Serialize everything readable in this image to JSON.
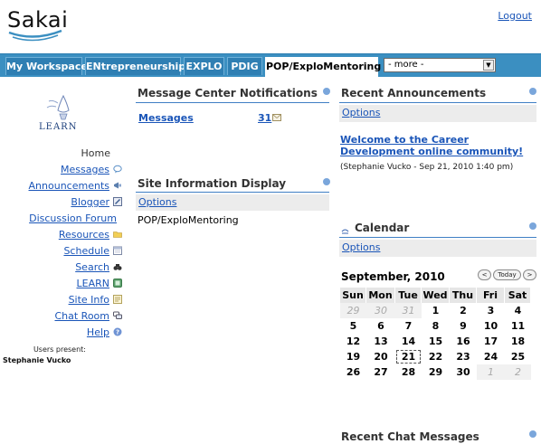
{
  "app": {
    "logo_text": "Sakai",
    "logout_label": "Logout"
  },
  "tabs": [
    {
      "label": "My Workspace"
    },
    {
      "label": "ENtrepreneurship"
    },
    {
      "label": "EXPLO"
    },
    {
      "label": "PDIG"
    },
    {
      "label": "POP/ExploMentoring",
      "selected": true
    }
  ],
  "more_select": {
    "value": "- more -"
  },
  "leftnav": {
    "logo_text": "LEARN",
    "home_label": "Home",
    "items": [
      {
        "label": "Messages",
        "icon": "speech-bubble-icon"
      },
      {
        "label": "Announcements",
        "icon": "megaphone-icon"
      },
      {
        "label": "Blogger",
        "icon": "blog-icon"
      },
      {
        "label": "Discussion Forum",
        "icon": ""
      },
      {
        "label": "Resources",
        "icon": "folder-icon"
      },
      {
        "label": "Schedule",
        "icon": "calendar-icon"
      },
      {
        "label": "Search",
        "icon": "binoculars-icon"
      },
      {
        "label": "LEARN",
        "icon": "learn-icon"
      },
      {
        "label": "Site Info",
        "icon": "site-info-icon"
      },
      {
        "label": "Chat Room",
        "icon": "chat-icon"
      },
      {
        "label": "Help",
        "icon": "help-icon"
      }
    ],
    "users_present_label": "Users present:",
    "users": [
      "Stephanie Vucko"
    ]
  },
  "message_center": {
    "title": "Message Center Notifications",
    "row_label": "Messages",
    "row_count": "31"
  },
  "site_info": {
    "title": "Site Information Display",
    "options_label": "Options",
    "site_name": "POP/ExploMentoring"
  },
  "announcements": {
    "title": "Recent Announcements",
    "options_label": "Options",
    "headline": "Welcome to the Career Development online community!",
    "byline": "(Stephanie Vucko - Sep 21, 2010 1:40 pm)"
  },
  "calendar": {
    "title": "Calendar",
    "options_label": "Options",
    "month_label": "September, 2010",
    "prev_label": "<",
    "today_label": "Today",
    "next_label": ">",
    "weekdays": [
      "Sun",
      "Mon",
      "Tue",
      "Wed",
      "Thu",
      "Fri",
      "Sat"
    ],
    "weeks": [
      [
        "29",
        "30",
        "31",
        "1",
        "2",
        "3",
        "4"
      ],
      [
        "5",
        "6",
        "7",
        "8",
        "9",
        "10",
        "11"
      ],
      [
        "12",
        "13",
        "14",
        "15",
        "16",
        "17",
        "18"
      ],
      [
        "19",
        "20",
        "21",
        "22",
        "23",
        "24",
        "25"
      ],
      [
        "26",
        "27",
        "28",
        "29",
        "30",
        "1",
        "2"
      ]
    ],
    "muted_cells": [
      "0-0",
      "0-1",
      "0-2",
      "4-5",
      "4-6"
    ],
    "today_cell": "3-2"
  },
  "chat": {
    "title": "Recent Chat Messages"
  },
  "colors": {
    "tab_bar": "#3b8fc1",
    "link": "#1a55b8",
    "portlet_line": "#3f7fc4"
  }
}
